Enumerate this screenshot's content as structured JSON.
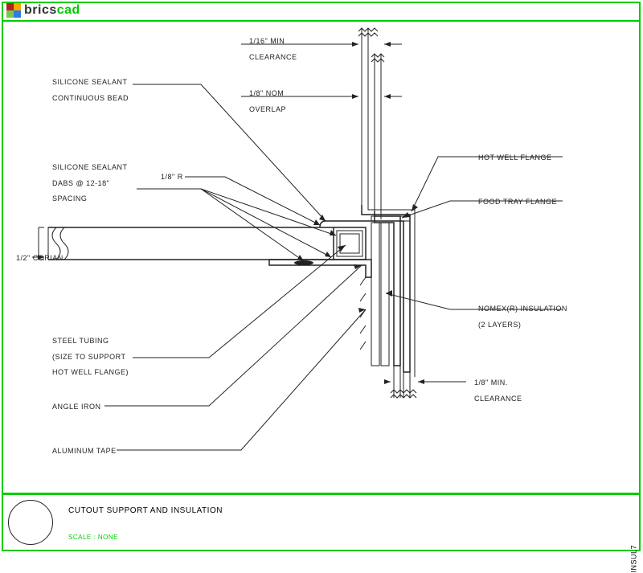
{
  "logo": {
    "brics": "brics",
    "cad": "cad"
  },
  "labels": {
    "clearance_top": {
      "l1": "1/16\"        MIN",
      "l2": "CLEARANCE"
    },
    "overlap": {
      "l1": "1/8\"       NOM",
      "l2": "OVERLAP"
    },
    "silicone_bead": {
      "l1": "SILICONE SEALANT",
      "l2": "CONTINUOUS BEAD"
    },
    "silicone_dabs": {
      "l1": "SILICONE SEALANT",
      "l2": "DABS @ 12-18\"",
      "l3": "SPACING"
    },
    "radius": "1/8\" R",
    "corian": "1/2\" CORIAN",
    "steel_tubing": {
      "l1": "STEEL TUBING",
      "l2": "(SIZE TO SUPPORT",
      "l3": "HOT WELL FLANGE)"
    },
    "angle_iron": "ANGLE IRON",
    "aluminum_tape": "ALUMINUM TAPE",
    "hot_well": "HOT WELL FLANGE",
    "food_tray": "FOOD TRAY FLANGE",
    "nomex": {
      "l1": "NOMEX(R) INSULATION",
      "l2": "(2 LAYERS)"
    },
    "clearance_bot": {
      "l1": "1/8\" MIN.",
      "l2": "CLEARANCE"
    }
  },
  "title": "CUTOUT SUPPORT AND INSULATION",
  "scale": "SCALE : NONE",
  "code": "INSUL7"
}
